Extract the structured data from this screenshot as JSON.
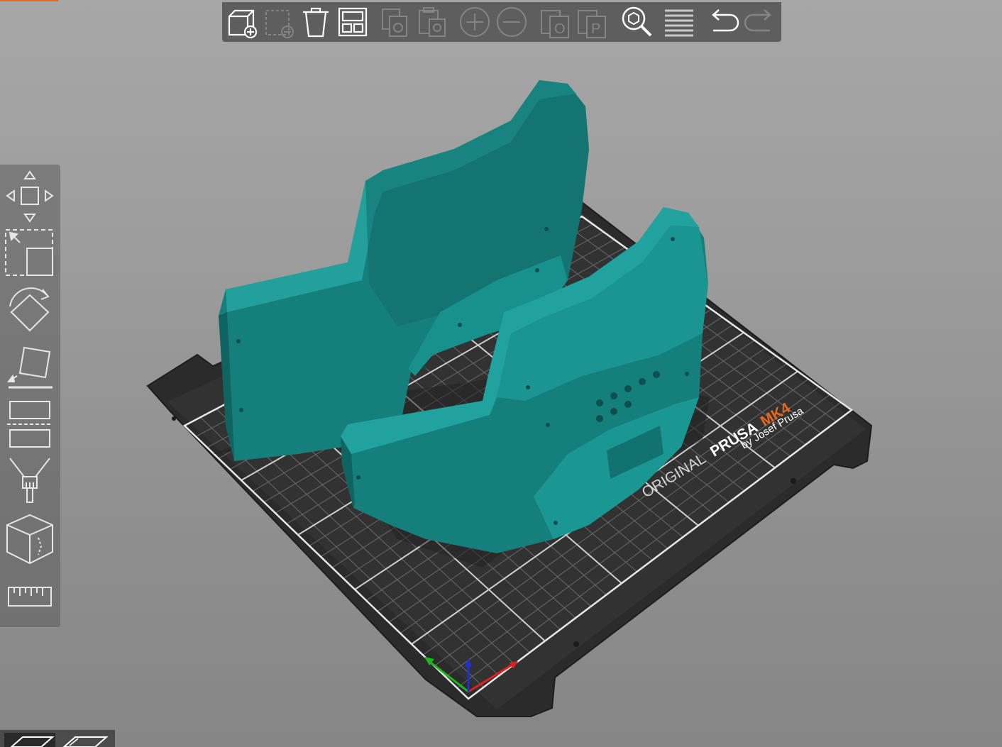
{
  "app": {
    "accent_color": "#e8691c",
    "model_color": "#1a8a87",
    "bed_color": "#303030"
  },
  "top_toolbar": {
    "buttons": [
      {
        "name": "add-object-icon",
        "enabled": true
      },
      {
        "name": "delete-object-icon",
        "enabled": false
      },
      {
        "name": "delete-all-icon",
        "enabled": true
      },
      {
        "name": "arrange-icon",
        "enabled": true
      },
      {
        "name": "copy-icon",
        "enabled": false
      },
      {
        "name": "paste-icon",
        "enabled": false
      },
      {
        "name": "add-instance-icon",
        "enabled": false
      },
      {
        "name": "remove-instance-icon",
        "enabled": false
      },
      {
        "name": "split-objects-icon",
        "enabled": false
      },
      {
        "name": "split-parts-icon",
        "enabled": false
      },
      {
        "name": "search-icon",
        "enabled": true
      },
      {
        "name": "layers-editing-icon",
        "enabled": true
      },
      {
        "name": "undo-icon",
        "enabled": true
      },
      {
        "name": "redo-icon",
        "enabled": false
      }
    ]
  },
  "left_toolbar": {
    "tools": [
      "move-tool-icon",
      "scale-tool-icon",
      "rotate-tool-icon",
      "place-on-face-icon",
      "cut-tool-icon",
      "paint-supports-icon",
      "seam-painting-icon",
      "measure-icon"
    ]
  },
  "bed": {
    "brand_prefix": "ORIGINAL",
    "brand_name": "PRUSA",
    "brand_model": "MK4",
    "brand_sub": "by Josef Prusa"
  },
  "bottom_tabs": [
    "view-3d-icon",
    "preview-icon"
  ]
}
